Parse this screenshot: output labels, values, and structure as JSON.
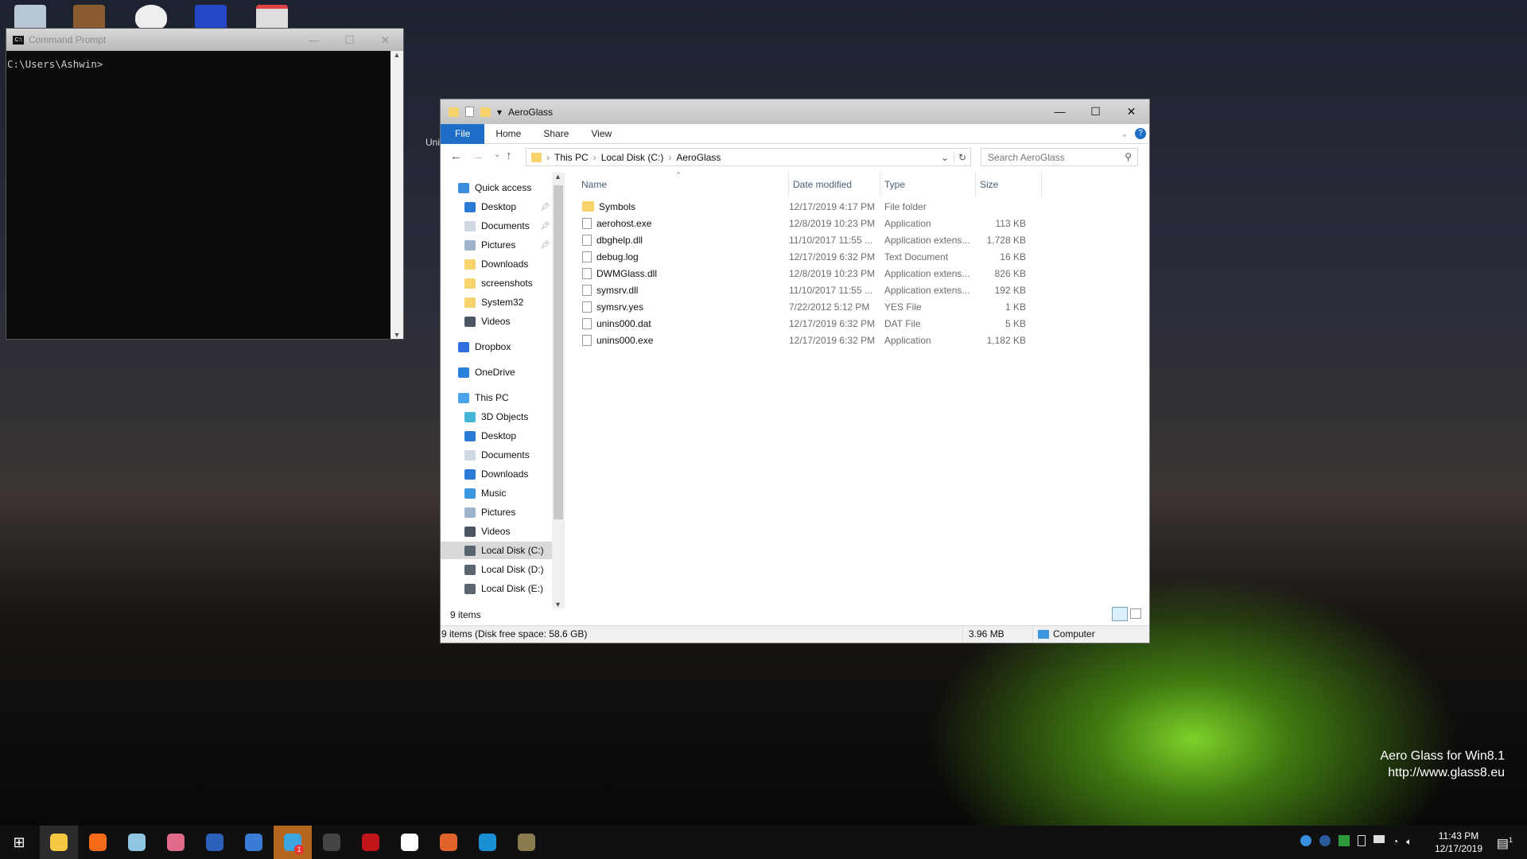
{
  "cmd": {
    "title": "Command Prompt",
    "prompt": "C:\\Users\\Ashwin>"
  },
  "explorer": {
    "title": "AeroGlass",
    "ribbon": {
      "tabs": [
        "File",
        "Home",
        "Share",
        "View"
      ]
    },
    "breadcrumb": [
      "This PC",
      "Local Disk (C:)",
      "AeroGlass"
    ],
    "search_placeholder": "Search AeroGlass",
    "nav": [
      {
        "label": "Quick access",
        "icon": "star-icon",
        "color": "#3b8de0"
      },
      {
        "label": "Desktop",
        "icon": "desktop-icon",
        "color": "#2b7bd6",
        "pinned": true
      },
      {
        "label": "Documents",
        "icon": "documents-icon",
        "color": "#cfd8e3",
        "pinned": true
      },
      {
        "label": "Pictures",
        "icon": "pictures-icon",
        "color": "#9fb5cc",
        "pinned": true
      },
      {
        "label": "Downloads",
        "icon": "folder-icon",
        "color": "#f6d36b"
      },
      {
        "label": "screenshots",
        "icon": "folder-icon",
        "color": "#f6d36b"
      },
      {
        "label": "System32",
        "icon": "folder-icon",
        "color": "#f6d36b"
      },
      {
        "label": "Videos",
        "icon": "videos-icon",
        "color": "#4b5563"
      },
      {
        "label": "Dropbox",
        "icon": "dropbox-icon",
        "color": "#2f6fe0"
      },
      {
        "label": "OneDrive",
        "icon": "cloud-icon",
        "color": "#2a82da"
      },
      {
        "label": "This PC",
        "icon": "computer-icon",
        "color": "#4aa3e6"
      },
      {
        "label": "3D Objects",
        "icon": "cube-icon",
        "color": "#45b6d8"
      },
      {
        "label": "Desktop",
        "icon": "desktop-icon",
        "color": "#2b7bd6"
      },
      {
        "label": "Documents",
        "icon": "documents-icon",
        "color": "#cfd8e3"
      },
      {
        "label": "Downloads",
        "icon": "download-arrow-icon",
        "color": "#2b7bd6"
      },
      {
        "label": "Music",
        "icon": "music-icon",
        "color": "#3a97e0"
      },
      {
        "label": "Pictures",
        "icon": "pictures-icon",
        "color": "#9fb5cc"
      },
      {
        "label": "Videos",
        "icon": "videos-icon",
        "color": "#4b5563"
      },
      {
        "label": "Local Disk (C:)",
        "icon": "drive-icon",
        "color": "#5a6570",
        "selected": true
      },
      {
        "label": "Local Disk (D:)",
        "icon": "drive-icon",
        "color": "#5a6570"
      },
      {
        "label": "Local Disk (E:)",
        "icon": "drive-icon",
        "color": "#5a6570"
      }
    ],
    "columns": [
      "Name",
      "Date modified",
      "Type",
      "Size"
    ],
    "files": [
      {
        "name": "Symbols",
        "date": "12/17/2019 4:17 PM",
        "type": "File folder",
        "size": "",
        "icon": "folder-icon"
      },
      {
        "name": "aerohost.exe",
        "date": "12/8/2019 10:23 PM",
        "type": "Application",
        "size": "113 KB",
        "icon": "exe-icon"
      },
      {
        "name": "dbghelp.dll",
        "date": "11/10/2017 11:55 ...",
        "type": "Application extens...",
        "size": "1,728 KB",
        "icon": "dll-icon"
      },
      {
        "name": "debug.log",
        "date": "12/17/2019 6:32 PM",
        "type": "Text Document",
        "size": "16 KB",
        "icon": "text-file-icon"
      },
      {
        "name": "DWMGlass.dll",
        "date": "12/8/2019 10:23 PM",
        "type": "Application extens...",
        "size": "826 KB",
        "icon": "dll-icon"
      },
      {
        "name": "symsrv.dll",
        "date": "11/10/2017 11:55 ...",
        "type": "Application extens...",
        "size": "192 KB",
        "icon": "dll-icon"
      },
      {
        "name": "symsrv.yes",
        "date": "7/22/2012 5:12 PM",
        "type": "YES File",
        "size": "1 KB",
        "icon": "file-icon"
      },
      {
        "name": "unins000.dat",
        "date": "12/17/2019 6:32 PM",
        "type": "DAT File",
        "size": "5 KB",
        "icon": "file-icon"
      },
      {
        "name": "unins000.exe",
        "date": "12/17/2019 6:32 PM",
        "type": "Application",
        "size": "1,182 KB",
        "icon": "installer-icon"
      }
    ],
    "item_count": "9 items",
    "status": {
      "left": "9 items (Disk free space: 58.6 GB)",
      "size": "3.96 MB",
      "location": "Computer"
    }
  },
  "desktop": {
    "partial_icon_label": "Uni",
    "watermark": [
      "Aero Glass for Win8.1",
      "http://www.glass8.eu"
    ]
  },
  "taskbar": {
    "apps": [
      {
        "name": "file-explorer",
        "color": "#f6c945",
        "active": true
      },
      {
        "name": "firefox",
        "color": "#f56b1a"
      },
      {
        "name": "notepad",
        "color": "#8fc7e0"
      },
      {
        "name": "snipping-tool",
        "color": "#e06a8a"
      },
      {
        "name": "word",
        "color": "#2b5fb8"
      },
      {
        "name": "thunderbird",
        "color": "#3a7bd5"
      },
      {
        "name": "telegram",
        "color": "#3ba5e0",
        "badge": "1",
        "highlight": "#b5651d"
      },
      {
        "name": "command-prompt",
        "color": "#444444"
      },
      {
        "name": "ladybug",
        "color": "#c0141a"
      },
      {
        "name": "mail",
        "color": "#ffffff"
      },
      {
        "name": "chrome-like",
        "color": "#e0632b"
      },
      {
        "name": "edge",
        "color": "#1b8fd6"
      },
      {
        "name": "monitor",
        "color": "#8a7a50"
      }
    ],
    "time": "11:43 PM",
    "date": "12/17/2019",
    "notifications": "1"
  }
}
